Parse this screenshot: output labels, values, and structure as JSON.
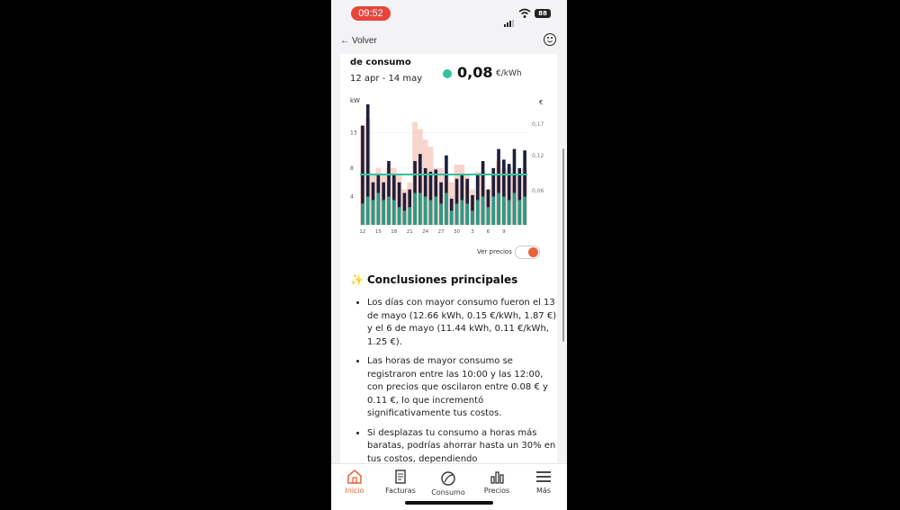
{
  "status": {
    "time": "09:52",
    "battery": "88"
  },
  "nav": {
    "back_label": "Volver"
  },
  "card": {
    "title": "de consumo",
    "date_range": "12 apr - 14 may",
    "price_value": "0,08",
    "price_unit": "€/kWh"
  },
  "chart_data": {
    "type": "bar",
    "left_axis_label": "kW",
    "right_axis_label": "€",
    "left_ticks": [
      "4",
      "8",
      "13"
    ],
    "right_ticks": [
      "0,06",
      "0,12",
      "0,17"
    ],
    "x_tick_labels": [
      "12",
      "15",
      "18",
      "21",
      "24",
      "27",
      "30",
      "3",
      "6",
      "9"
    ],
    "ylim": [
      0,
      17
    ],
    "price_line_kw": 7.1,
    "series": [
      {
        "name": "",
        "values": [
          14,
          17,
          6,
          7,
          6,
          9,
          7,
          6,
          4.5,
          5,
          9,
          10,
          8,
          7.5,
          7.8,
          6,
          9.8,
          3.7,
          6.5,
          7,
          6.5,
          4.2,
          7,
          9,
          5,
          8,
          10.7,
          9.2,
          8.6,
          10.7,
          8,
          10.5
        ]
      },
      {
        "name": "",
        "values": [
          14,
          15,
          7,
          8,
          7,
          8,
          8,
          7,
          5,
          6,
          14.5,
          13.5,
          12,
          11,
          8,
          8,
          7,
          6,
          8.5,
          8.5,
          7,
          5,
          7.5,
          7.5,
          5,
          7,
          9,
          8,
          8,
          7,
          7,
          8
        ]
      },
      {
        "name": "",
        "values": [
          3,
          4,
          3.5,
          4.5,
          3.5,
          4,
          3.5,
          2.5,
          2,
          2.5,
          4.5,
          4.5,
          4,
          3.5,
          4,
          3,
          4.5,
          2,
          3,
          3.5,
          3,
          2,
          3.5,
          4,
          2.5,
          4,
          4.5,
          4,
          3.5,
          4.5,
          3.5,
          4
        ]
      }
    ]
  },
  "toggle": {
    "label": "Ver precios",
    "on": true
  },
  "conclusions": {
    "heading": "Conclusiones principales",
    "items": [
      "Los días con mayor consumo fueron el 13 de mayo (12.66 kWh, 0.15 €/kWh, 1.87 €) y el 6 de mayo (11.44 kWh, 0.11 €/kWh, 1.25 €).",
      "Las horas de mayor consumo se registraron entre las 10:00 y las 12:00, con precios que oscilaron entre 0.08 € y 0.11 €, lo que incrementó significativamente tus costos.",
      "Si desplazas tu consumo a horas más baratas, podrías ahorrar hasta un 30% en tus costos, dependiendo"
    ]
  },
  "tabs": [
    {
      "label": "Inicio",
      "icon": "home-icon",
      "active": true
    },
    {
      "label": "Facturas",
      "icon": "document-icon",
      "active": false
    },
    {
      "label": "Consumo",
      "icon": "leaf-icon",
      "active": false
    },
    {
      "label": "Precios",
      "icon": "bar-chart-icon",
      "active": false
    },
    {
      "label": "Más",
      "icon": "menu-icon",
      "active": false
    }
  ],
  "colors": {
    "accent": "#e8633a",
    "teal": "#2fc4a0",
    "navy": "#1c1f3a",
    "salmon": "#f2b3a2",
    "status_red": "#e8453c"
  }
}
